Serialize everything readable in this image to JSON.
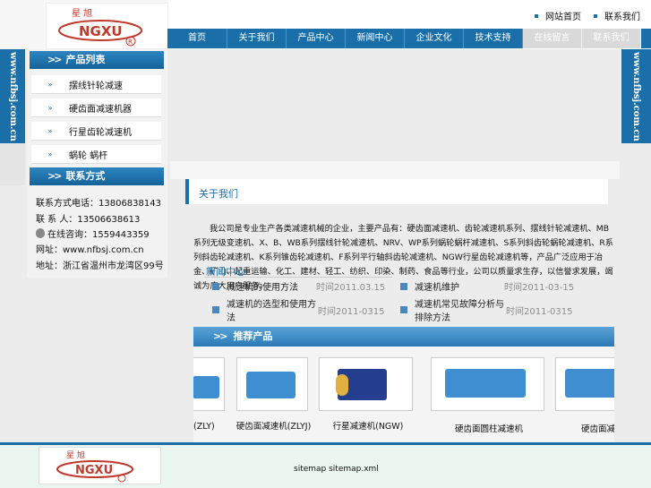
{
  "header": {
    "top_links": [
      "网站首页",
      "联系我们"
    ]
  },
  "nav": {
    "items": [
      "首页",
      "关于我们",
      "产品中心",
      "新闻中心",
      "企业文化",
      "技术支持",
      "在线留言",
      "联系我们"
    ]
  },
  "banner_text": "www.nfbsj.com.cn",
  "sidebar": {
    "products_title": "产品列表",
    "products": [
      "摆线针轮减速",
      "硬齿面减速机器",
      "行星齿轮减速机",
      "蜗轮 蜗杆"
    ],
    "contact_title": "联系方式",
    "contacts": [
      "联系方式电话：13806838143",
      "联  系  人：13506638613",
      "在线咨询：1559443359",
      "网址：www.nfbsj.com.cn",
      "地址：浙江省温州市龙湾区99号"
    ]
  },
  "about": {
    "title": "关于我们",
    "text_before": "我公司是专业生产各类减速机械的企业，主要产品有：硬齿面减速机、齿轮减速机系列、摆线针轮减速机、MB系列无级变速机、X、B、WB系列摆线针轮减速机、NRV、WP系列蜗轮蜗杆减速机、S系列斜齿轮蜗轮减速机、R系列斜齿轮减速机、K系列锥齿轮减速机、F系列平行轴斜齿轮减速机、NGW行星齿轮减速机等，产品广泛应用于冶金、矿山、起重运输、化工、建材、轻工、纺织、印染、制药、食品等行业，公司以质量求生存，以信誉求发展，竭诚为广大用户服务。"
  },
  "news": {
    "title": "新闻中心",
    "items": [
      {
        "title": "减速机的使用方法",
        "date": "时间2011.03.15"
      },
      {
        "title": "减速机维护",
        "date": "时间2011-03-15"
      },
      {
        "title": "减速机的选型和使用方法",
        "date": "时间2011-0315"
      },
      {
        "title": "减速机常见故障分析与排除方法",
        "date": "时间2011-0315"
      }
    ]
  },
  "recommend": {
    "title": "推荐产品",
    "products": [
      {
        "label": "(ZLY)"
      },
      {
        "label": "硬齿面减速机(ZLYJ)"
      },
      {
        "label": "行星减速机(NGW)"
      },
      {
        "label": "硬齿面圆柱减速机"
      },
      {
        "label": "硬齿面减速机"
      }
    ]
  },
  "footer": {
    "text": "sitemap sitemap.xml"
  },
  "colors": {
    "brand_blue": "#1b6fa8",
    "nav_light": "#d9d9d9",
    "footer_bg": "#eaf6ef"
  }
}
